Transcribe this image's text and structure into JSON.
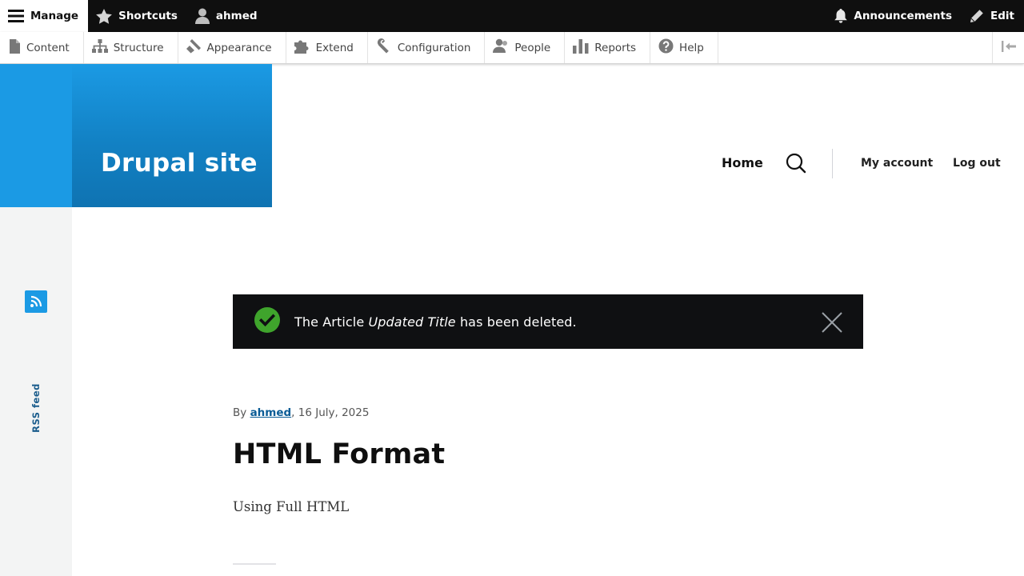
{
  "toolbar": {
    "manage_label": "Manage",
    "shortcuts_label": "Shortcuts",
    "user_label": "ahmed",
    "announcements_label": "Announcements",
    "edit_label": "Edit"
  },
  "tray": {
    "items": [
      {
        "label": "Content",
        "icon": "file-icon"
      },
      {
        "label": "Structure",
        "icon": "sitemap-icon"
      },
      {
        "label": "Appearance",
        "icon": "paintbrush-icon"
      },
      {
        "label": "Extend",
        "icon": "puzzle-icon"
      },
      {
        "label": "Configuration",
        "icon": "wrench-icon"
      },
      {
        "label": "People",
        "icon": "people-icon"
      },
      {
        "label": "Reports",
        "icon": "bar-chart-icon"
      },
      {
        "label": "Help",
        "icon": "help-icon"
      }
    ]
  },
  "site": {
    "name": "Drupal site"
  },
  "nav": {
    "home": "Home",
    "my_account": "My account",
    "log_out": "Log out"
  },
  "sidebar": {
    "rss_label": "RSS feed"
  },
  "status": {
    "prefix": "The Article",
    "title": "Updated Title",
    "suffix": "has been deleted."
  },
  "article": {
    "by_label": "By",
    "author": "ahmed",
    "date": ", 16 July, 2025",
    "title": "HTML Format",
    "body": "Using Full HTML"
  },
  "colors": {
    "toolbar_bg": "#0f0f0f",
    "brand_blue": "#1b9ae4",
    "brand_dark": "#0f73b2",
    "status_bg": "#0f1012",
    "status_success": "#3fa42c",
    "link": "#0a5c96"
  }
}
